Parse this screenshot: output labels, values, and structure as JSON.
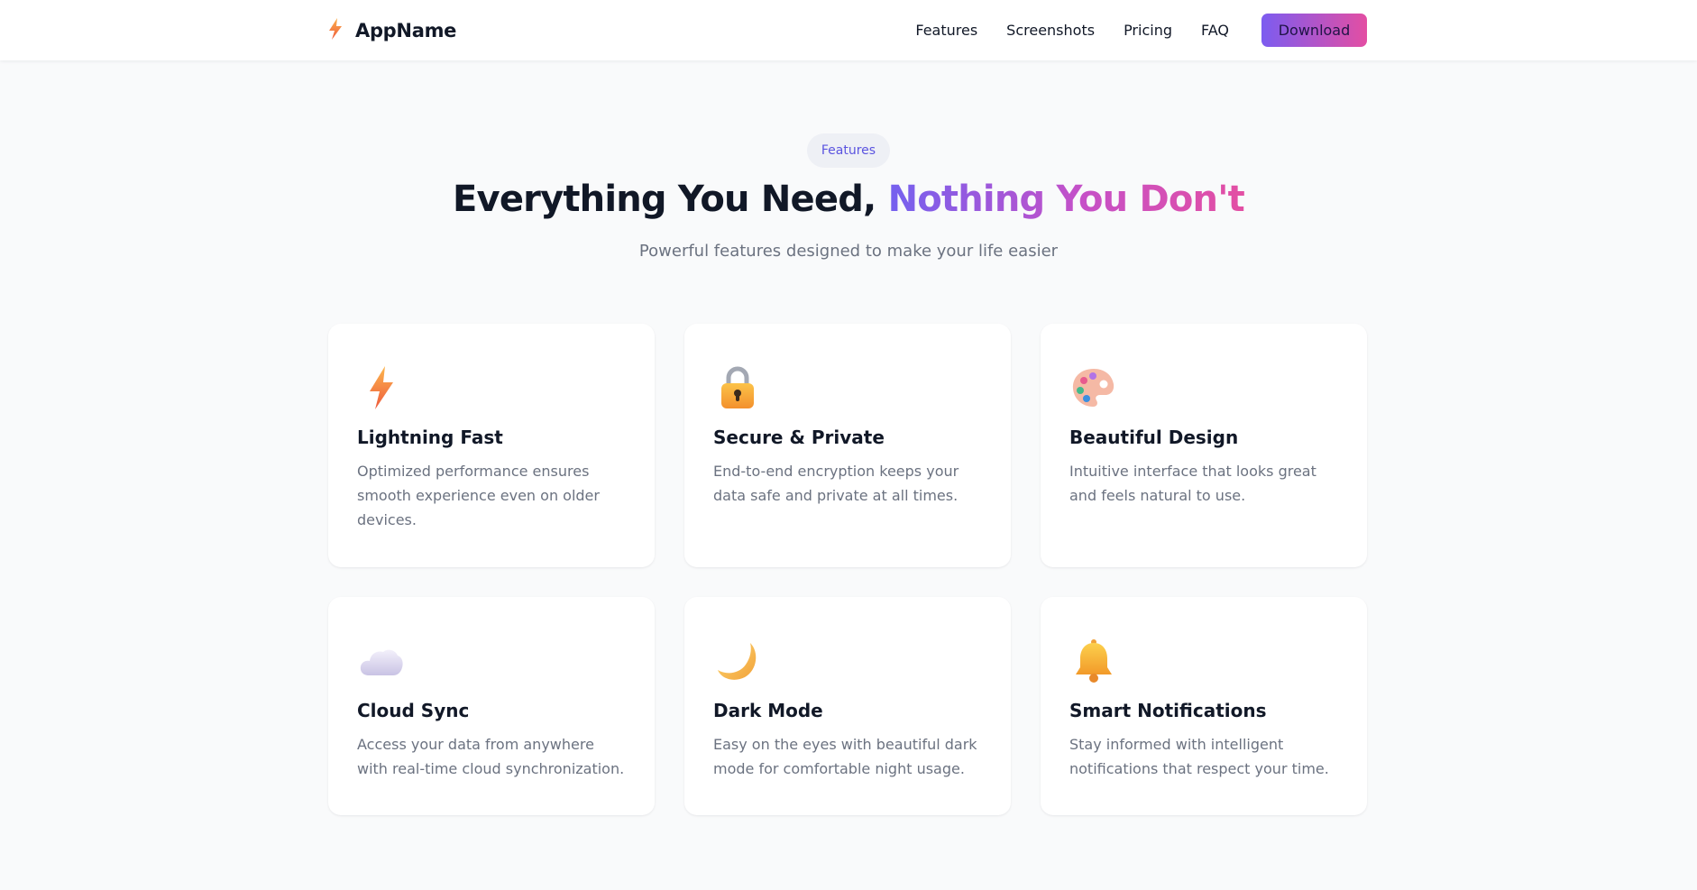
{
  "nav": {
    "brand_name": "AppName",
    "links": [
      "Features",
      "Screenshots",
      "Pricing",
      "FAQ"
    ],
    "download_label": "Download"
  },
  "hero": {
    "badge": "Features",
    "title_plain": "Everything You Need, ",
    "title_accent": "Nothing You Don't",
    "subtitle": "Powerful features designed to make your life easier"
  },
  "features": [
    {
      "icon": "lightning-icon",
      "title": "Lightning Fast",
      "description": "Optimized performance ensures smooth experience even on older devices."
    },
    {
      "icon": "lock-icon",
      "title": "Secure & Private",
      "description": "End-to-end encryption keeps your data safe and private at all times."
    },
    {
      "icon": "palette-icon",
      "title": "Beautiful Design",
      "description": "Intuitive interface that looks great and feels natural to use."
    },
    {
      "icon": "cloud-icon",
      "title": "Cloud Sync",
      "description": "Access your data from anywhere with real-time cloud synchronization."
    },
    {
      "icon": "moon-icon",
      "title": "Dark Mode",
      "description": "Easy on the eyes with beautiful dark mode for comfortable night usage."
    },
    {
      "icon": "bell-icon",
      "title": "Smart Notifications",
      "description": "Stay informed with intelligent notifications that respect your time."
    }
  ],
  "colors": {
    "accent_start": "#7c5cf0",
    "accent_end": "#e34ea3",
    "badge_text": "#5b54e0",
    "page_background": "#f9fafb"
  }
}
